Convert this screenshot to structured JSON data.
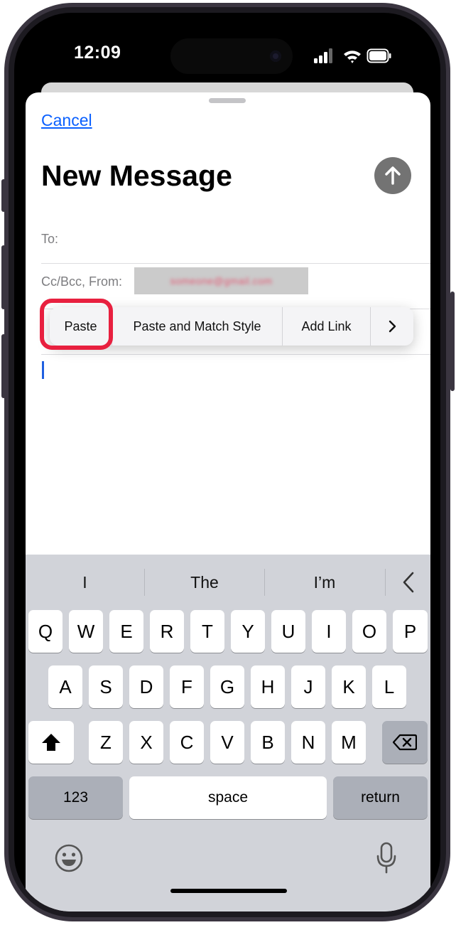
{
  "status_bar": {
    "time": "12:09"
  },
  "compose": {
    "cancel_label": "Cancel",
    "title": "New Message",
    "to_label": "To:",
    "cc_from_label": "Cc/Bcc, From:",
    "from_email_obscured": "someone@gmail.com"
  },
  "edit_menu": {
    "items": [
      "Paste",
      "Paste and Match Style",
      "Add Link"
    ],
    "more_icon": "chevron-right-icon",
    "highlight_color": "#e8203f"
  },
  "keyboard": {
    "suggestions": [
      "I",
      "The",
      "I’m"
    ],
    "row1": [
      "Q",
      "W",
      "E",
      "R",
      "T",
      "Y",
      "U",
      "I",
      "O",
      "P"
    ],
    "row2": [
      "A",
      "S",
      "D",
      "F",
      "G",
      "H",
      "J",
      "K",
      "L"
    ],
    "row3": [
      "Z",
      "X",
      "C",
      "V",
      "B",
      "N",
      "M"
    ],
    "numbers_label": "123",
    "space_label": "space",
    "return_label": "return"
  },
  "colors": {
    "accent": "#0a60ff",
    "send_button": "#737373",
    "keyboard_bg": "#d1d3d9"
  }
}
